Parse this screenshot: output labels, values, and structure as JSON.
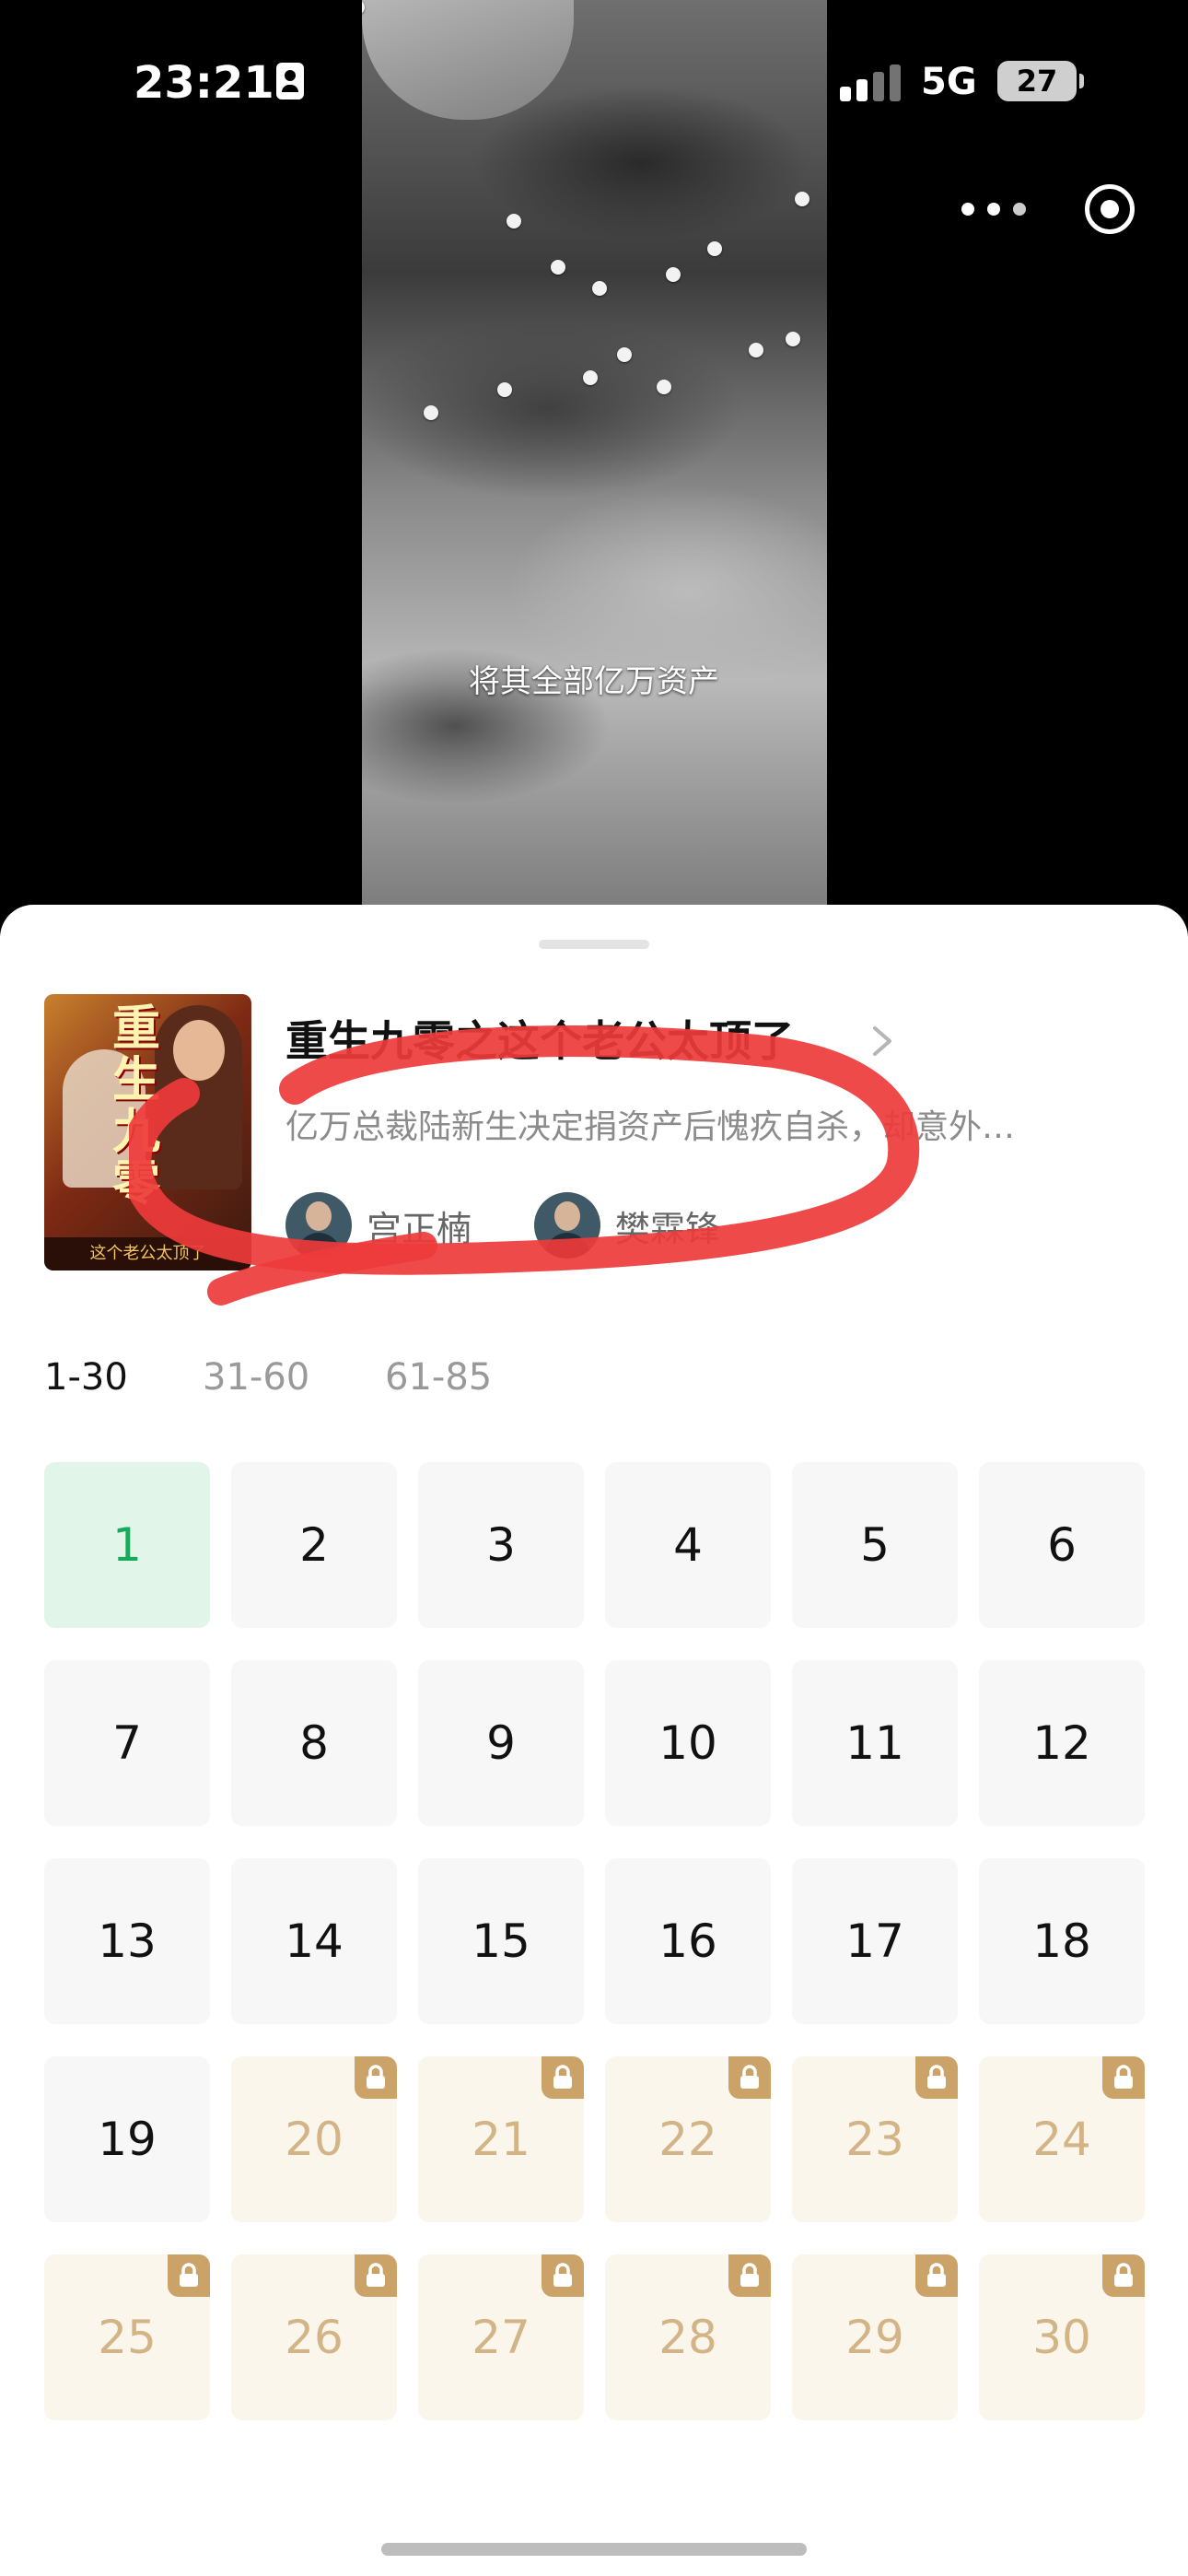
{
  "status_bar": {
    "time": "23:21",
    "network": "5G",
    "battery": "27"
  },
  "video": {
    "subtitle": "将其全部亿万资产"
  },
  "drama": {
    "title": "重生九零之这个老公太顶了",
    "description": "亿万总裁陆新生决定捐资产后愧疚自杀，却意外…",
    "poster_logo": "重生九零之",
    "poster_band": "这个老公太顶了",
    "cast": [
      {
        "name": "宫正楠"
      },
      {
        "name": "樊霖锋"
      }
    ]
  },
  "range_tabs": [
    {
      "label": "1-30",
      "active": true
    },
    {
      "label": "31-60",
      "active": false
    },
    {
      "label": "61-85",
      "active": false
    }
  ],
  "episodes": {
    "current": "1",
    "items": [
      "1",
      "2",
      "3",
      "4",
      "5",
      "6",
      "7",
      "8",
      "9",
      "10",
      "11",
      "12",
      "13",
      "14",
      "15",
      "16",
      "17",
      "18",
      "19",
      "20",
      "21",
      "22",
      "23",
      "24",
      "25",
      "26",
      "27",
      "28",
      "29",
      "30"
    ],
    "locked_from": 20
  },
  "colors": {
    "current_episode_bg": "#e2f5e9",
    "current_episode_text": "#1aa85b",
    "locked_episode_bg": "#fbf6ec",
    "locked_episode_text": "#d3b487",
    "lock_badge": "#cba268",
    "annotation_red": "#ee3b3b"
  },
  "icons": {
    "lock": "lock-icon",
    "chevron": "chevron-right-icon",
    "more": "more-dots-icon",
    "close": "target-close-icon"
  }
}
